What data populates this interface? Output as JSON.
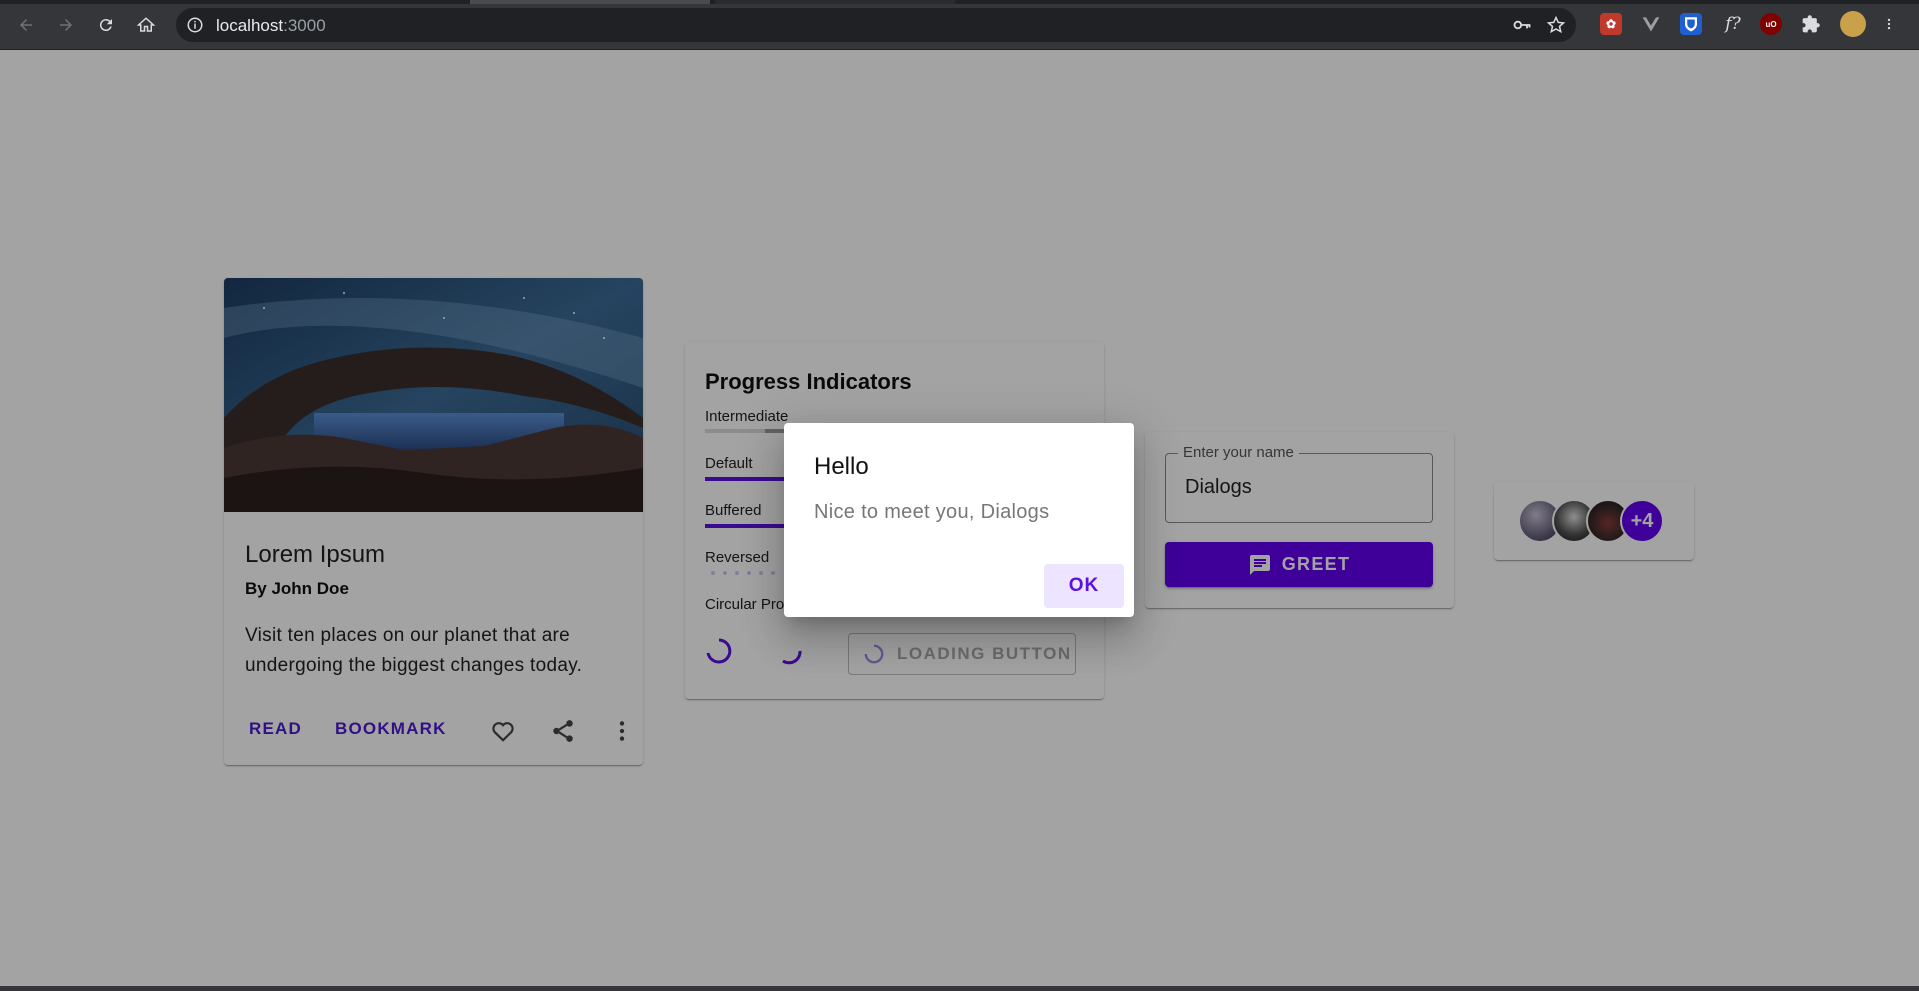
{
  "browser": {
    "url_host": "localhost",
    "url_port": ":3000",
    "extensions": [
      "ext-red-icon",
      "vuejs-icon",
      "shield-ext-icon",
      "function-ext-icon",
      "ublock-icon",
      "puzzle-icon",
      "profile-avatar-icon"
    ]
  },
  "media_card": {
    "title": "Lorem Ipsum",
    "subtitle": "By John Doe",
    "body": "Visit ten places on our planet that are undergoing the biggest changes today.",
    "read_label": "READ",
    "bookmark_label": "BOOKMARK"
  },
  "progress_card": {
    "title": "Progress Indicators",
    "intermediate_label": "Intermediate",
    "default_label": "Default",
    "default_progress": 0.5,
    "buffered_label": "Buffered",
    "buffered_progress": 0.35,
    "reversed_label": "Reversed",
    "circular_label": "Circular Progress",
    "loading_button_label": "LOADING BUTTON"
  },
  "greet_card": {
    "input_label": "Enter your name",
    "input_value": "Dialogs",
    "greet_label": "GREET"
  },
  "avatar_group": {
    "overflow_label": "+4"
  },
  "dialog": {
    "title": "Hello",
    "message": "Nice to meet you, Dialogs",
    "ok_label": "OK"
  },
  "colors": {
    "primary": "#6200ee",
    "chrome_bg": "#35363a",
    "backdrop": "rgba(0,0,0,0.36)"
  }
}
